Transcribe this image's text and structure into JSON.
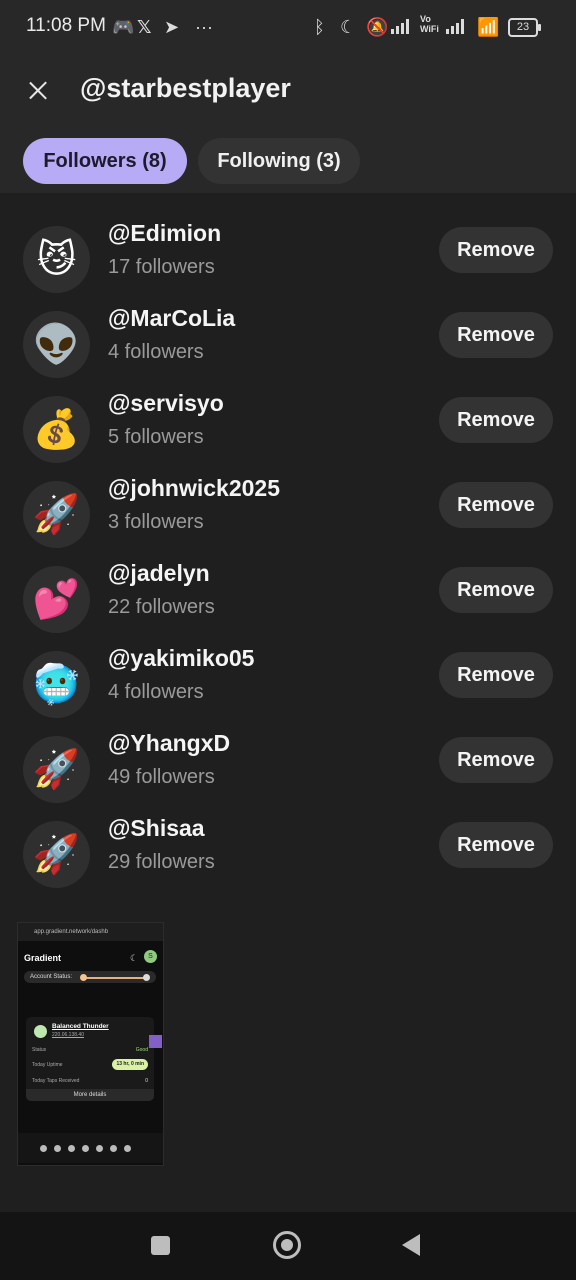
{
  "status_bar": {
    "time": "11:08 PM",
    "left_icons": [
      "discord-icon",
      "x-icon",
      "telegram-icon",
      "more-dots-icon"
    ],
    "right_icons": [
      "bluetooth-icon",
      "moon-icon",
      "bell-off-icon",
      "signal-icon",
      "vowifi-icon",
      "signal-icon",
      "wifi-icon"
    ],
    "vowifi_label": "Vo\nWiFi",
    "battery": "23"
  },
  "header": {
    "title": "@starbestplayer"
  },
  "tabs": [
    {
      "label": "Followers (8)",
      "active": true
    },
    {
      "label": "Following (3)",
      "active": false
    }
  ],
  "followers": [
    {
      "avatar": "😼",
      "username": "@Edimion",
      "followers": "17 followers",
      "action": "Remove"
    },
    {
      "avatar": "👽",
      "username": "@MarCoLia",
      "followers": "4 followers",
      "action": "Remove"
    },
    {
      "avatar": "💰",
      "username": "@servisyo",
      "followers": "5 followers",
      "action": "Remove"
    },
    {
      "avatar": "🚀",
      "username": "@johnwick2025",
      "followers": "3 followers",
      "action": "Remove"
    },
    {
      "avatar": "💕",
      "username": "@jadelyn",
      "followers": "22 followers",
      "action": "Remove"
    },
    {
      "avatar": "🥶",
      "username": "@yakimiko05",
      "followers": "4 followers",
      "action": "Remove"
    },
    {
      "avatar": "🚀",
      "username": "@YhangxD",
      "followers": "49 followers",
      "action": "Remove"
    },
    {
      "avatar": "🚀",
      "username": "@Shisaa",
      "followers": "29 followers",
      "action": "Remove"
    }
  ],
  "screenshot_thumbnail": {
    "url": "app.gradient.network/dashb",
    "brand": "Gradient",
    "account_status": "Account Status:",
    "node_name": "Balanced Thunder",
    "node_ip": "220.06.138.40",
    "status_label": "Status",
    "status_value": "Good",
    "uptime_label": "Today Uptime",
    "uptime_value": "13 hr, 0 min",
    "taps_label": "Today Taps Received",
    "taps_value": "0",
    "more_details": "More details"
  },
  "nav_bar": {
    "buttons": [
      "recents-button",
      "home-button",
      "back-button"
    ]
  }
}
